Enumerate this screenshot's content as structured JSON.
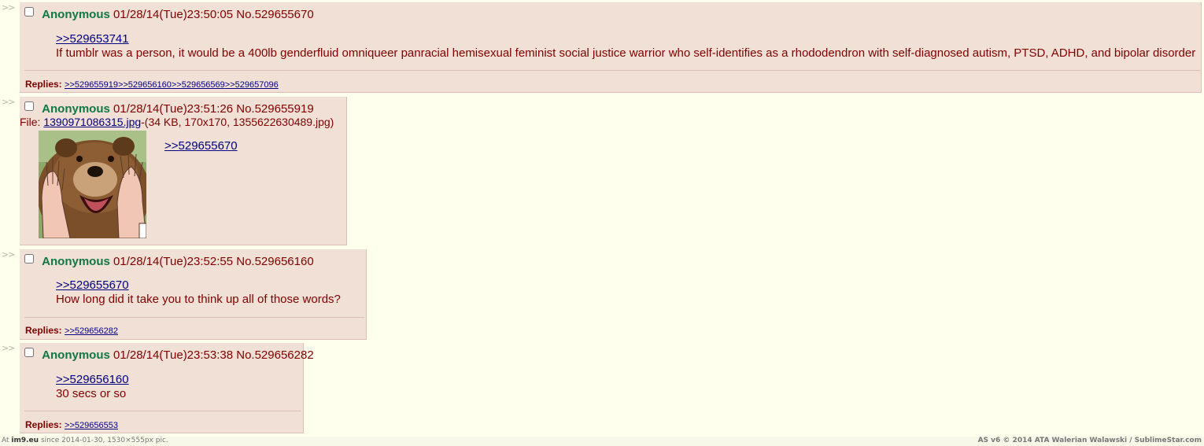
{
  "arrow_text": ">>",
  "posts": [
    {
      "name": "Anonymous",
      "datetime": "01/28/14(Tue)23:50:05",
      "postnum": "No.529655670",
      "quote": ">>529653741",
      "text": "If tumblr was a person, it would be a 400lb genderfluid omniqueer panracial hemisexual feminist social justice warrior who self-identifies as a rhododendron with self-diagnosed autism, PTSD, ADHD, and bipolar disorder",
      "replies_label": "Replies:",
      "replies": [
        ">>529655919",
        ">>529656160",
        ">>529656569",
        ">>529657096"
      ]
    },
    {
      "name": "Anonymous",
      "datetime": "01/28/14(Tue)23:51:26",
      "postnum": "No.529655919",
      "file_label": "File:",
      "file_name": "1390971086315.jpg",
      "file_info": "-(34 KB, 170x170, 1355622630489.jpg)",
      "quote": ">>529655670"
    },
    {
      "name": "Anonymous",
      "datetime": "01/28/14(Tue)23:52:55",
      "postnum": "No.529656160",
      "quote": ">>529655670",
      "text": "How long did it take you to think up all of those words?",
      "replies_label": "Replies:",
      "replies": [
        ">>529656282"
      ]
    },
    {
      "name": "Anonymous",
      "datetime": "01/28/14(Tue)23:53:38",
      "postnum": "No.529656282",
      "quote": ">>529656160",
      "text": "30 secs or so",
      "replies_label": "Replies:",
      "replies": [
        ">>529656553"
      ]
    }
  ],
  "footer": {
    "at": "At",
    "site": "im9.eu",
    "since": "since 2014-01-30, 1530×555px pic.",
    "right": "AS v6 © 2014 ATA Walerian Walawski / SublimeStar.com"
  },
  "colors": {
    "background": "#FFFFEE",
    "post_bg": "#F0E0D6",
    "name": "#117743",
    "text": "#800000",
    "link": "#000080"
  }
}
